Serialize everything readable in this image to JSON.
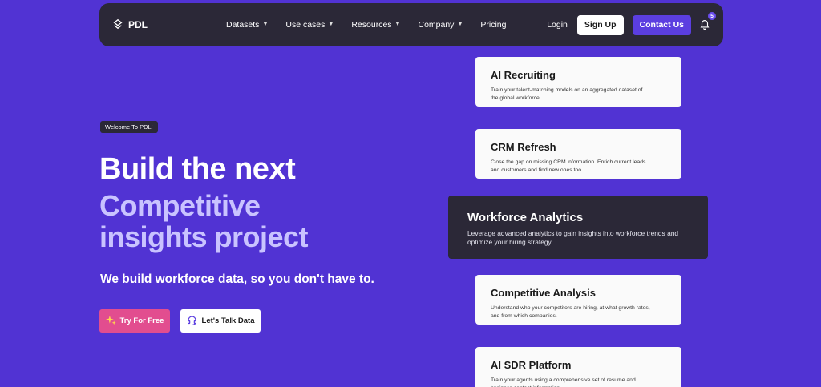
{
  "nav": {
    "logo_text": "PDL",
    "menu": [
      {
        "label": "Datasets"
      },
      {
        "label": "Use cases"
      },
      {
        "label": "Resources"
      },
      {
        "label": "Company"
      },
      {
        "label": "Pricing"
      }
    ],
    "login": "Login",
    "signup": "Sign Up",
    "contact": "Contact Us",
    "notification_count": "5"
  },
  "hero": {
    "badge": "Welcome To PDL!",
    "headline": "Build the next",
    "highlight": "Competitive insights project",
    "subheadline": "We build workforce data, so you don't have to.",
    "cta_primary": "Try For Free",
    "cta_secondary": "Let's Talk Data"
  },
  "cards": [
    {
      "title": "AI Recruiting",
      "desc": "Train your talent-matching models on an aggregated dataset of the global workforce."
    },
    {
      "title": "CRM Refresh",
      "desc": "Close the gap on missing CRM information. Enrich current leads and customers and find new ones too."
    },
    {
      "title": "Workforce Analytics",
      "desc": "Leverage advanced analytics to gain insights into workforce trends and optimize your hiring strategy."
    },
    {
      "title": "Competitive Analysis",
      "desc": "Understand who your competitors are hiring, at what growth rates, and from which companies."
    },
    {
      "title": "AI SDR Platform",
      "desc": "Train your agents using a comprehensive set of resume and business contact information."
    }
  ],
  "colors": {
    "background": "#5133d3",
    "nav_bg": "#2b2837",
    "highlight_text": "#c9c3ff",
    "cta_primary": "#e24d8f",
    "contact_button": "#5b3ee0"
  }
}
